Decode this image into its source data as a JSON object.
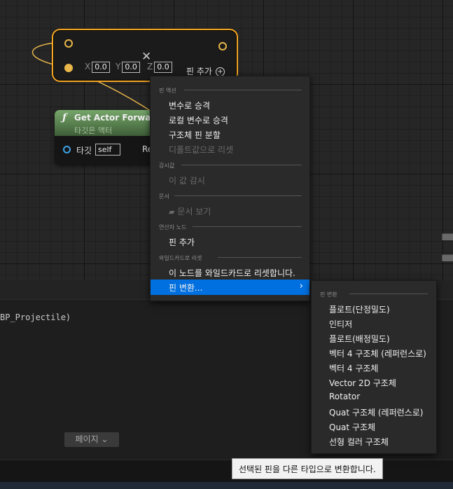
{
  "make_node": {
    "x_label": "X",
    "x_value": "0.0",
    "y_label": "Y",
    "y_value": "0.0",
    "z_label": "Z",
    "z_value": "0.0",
    "add_pin_label": "핀 추가"
  },
  "function_node": {
    "title": "Get Actor Forward",
    "subtitle": "타깃은 액터",
    "target_label": "타깃",
    "target_value": "self",
    "return_label": "Re"
  },
  "context_menu": {
    "sections": [
      {
        "header": "핀 액션",
        "items": [
          {
            "label": "변수로 승격",
            "enabled": true
          },
          {
            "label": "로컬 변수로 승격",
            "enabled": true
          },
          {
            "label": "구조체 핀 분할",
            "enabled": true
          },
          {
            "label": "디폴트값으로 리셋",
            "enabled": false
          }
        ]
      },
      {
        "header": "감시값",
        "items": [
          {
            "label": "이 값 감시",
            "enabled": false
          }
        ]
      },
      {
        "header": "문서",
        "items": [
          {
            "label": "문서 보기",
            "enabled": false
          }
        ]
      },
      {
        "header": "연산자 노드",
        "items": [
          {
            "label": "핀 추가",
            "enabled": true
          }
        ]
      },
      {
        "header": "와일드카드로 리셋",
        "items": [
          {
            "label": "이 노드를 와일드카드로 리셋합니다.",
            "enabled": true
          },
          {
            "label": "핀 변환...",
            "enabled": true,
            "selected": true
          }
        ]
      }
    ]
  },
  "submenu": {
    "header": "핀 변환",
    "items": [
      "플로트(단정밀도)",
      "인티저",
      "플로트(배정밀도)",
      "벡터 4 구조체 (레퍼런스로)",
      "벡터 4 구조체",
      "Vector 2D 구조체",
      "Rotator",
      "Quat 구조체 (레퍼런스로)",
      "Quat 구조체",
      "선형 컬러 구조체"
    ]
  },
  "output_log": {
    "text": "BP_Projectile)"
  },
  "page_button": "페이지",
  "tooltip": "선택된 핀을 다른 타입으로 변환합니다.",
  "colors": {
    "selection": "#0070e0",
    "exec_node_border": "#f5a623",
    "pin_float": "#e8b64a",
    "pin_object": "#3ea3e6"
  },
  "icons": [
    "close-icon",
    "add-circle-icon",
    "function-icon",
    "document-icon",
    "chevron-right-icon",
    "chevron-down-icon"
  ]
}
